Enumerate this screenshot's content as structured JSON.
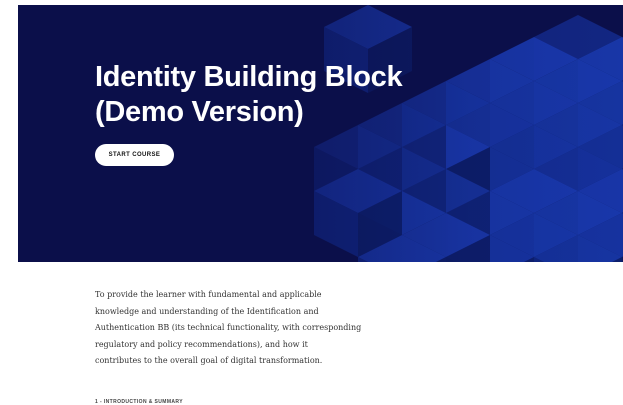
{
  "course": {
    "title_lines": [
      "Identity Building Block",
      "(Demo Version)"
    ],
    "start_button_label": "START COURSE"
  },
  "description": {
    "lines": [
      "To provide the learner with fundamental and applicable",
      "knowledge and understanding of the Identification and",
      "Authentication BB (its technical functionality, with corresponding",
      "regulatory and policy recommendations), and how it",
      "contributes to the overall goal of digital transformation."
    ]
  },
  "lessons": {
    "first_label": "1 - INTRODUCTION & SUMMARY"
  },
  "colors": {
    "hero_background": "#0b0f4a",
    "cube_light": "#1a3ab0",
    "cube_mid": "#122c8f",
    "cube_dark": "#0c1d66"
  }
}
